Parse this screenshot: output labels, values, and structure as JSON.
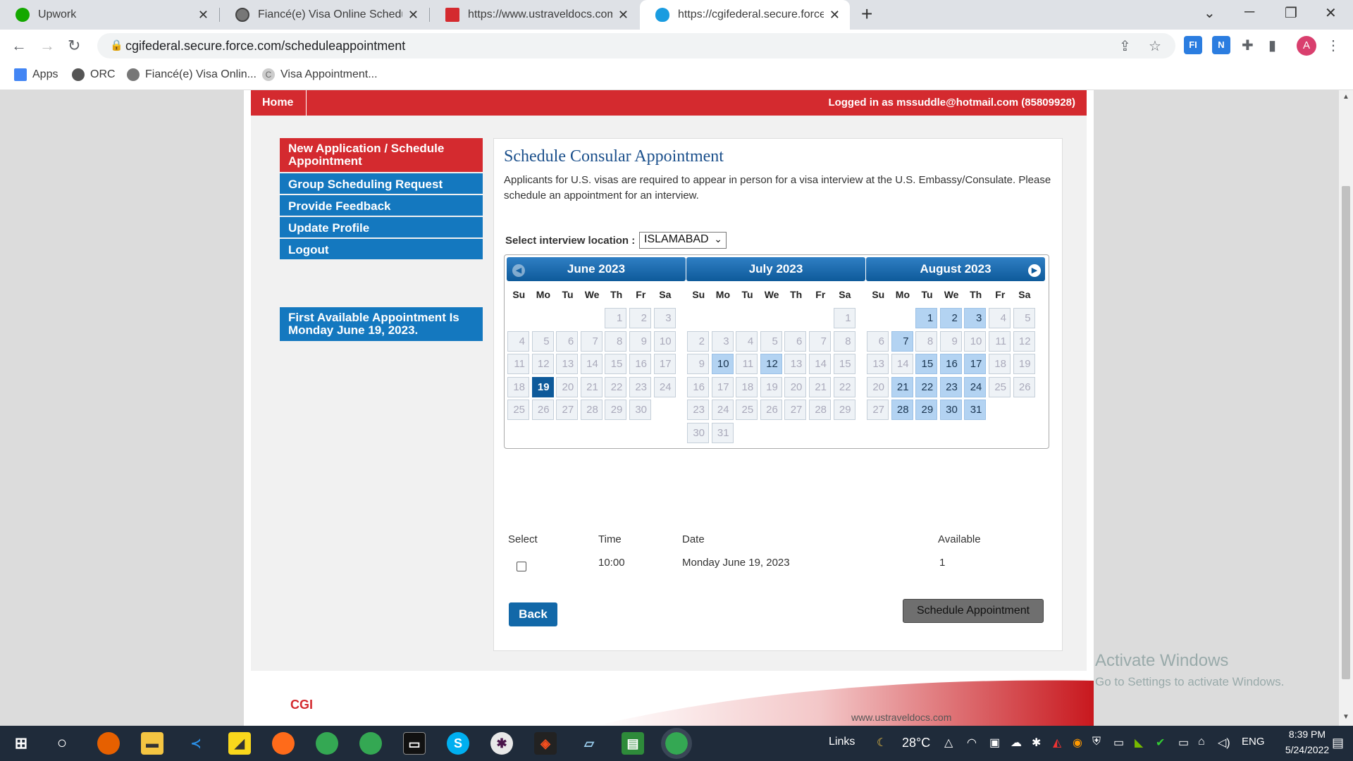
{
  "browser": {
    "tabs": [
      {
        "title": "Upwork"
      },
      {
        "title": "Fiancé(e) Visa Online Scheduling"
      },
      {
        "title": "https://www.ustraveldocs.com/pk"
      },
      {
        "title": "https://cgifederal.secure.force.com"
      }
    ],
    "url": "cgifederal.secure.force.com/scheduleappointment",
    "bookmarks": [
      "Apps",
      "ORC",
      "Fiancé(e) Visa Onlin...",
      "Visa Appointment..."
    ],
    "avatar_letter": "A"
  },
  "header": {
    "home_label": "Home",
    "logged_in_text": "Logged in as  mssuddle@hotmail.com (85809928)"
  },
  "sidebar": {
    "items": [
      {
        "label": "New Application / Schedule Appointment"
      },
      {
        "label": "Group Scheduling Request"
      },
      {
        "label": "Provide Feedback"
      },
      {
        "label": "Update Profile"
      },
      {
        "label": "Logout"
      }
    ],
    "first_available": "First Available Appointment Is Monday June 19, 2023."
  },
  "main": {
    "title": "Schedule Consular Appointment",
    "description": "Applicants for U.S. visas are required to appear in person for a visa interview at the U.S. Embassy/Consulate. Please schedule an appointment for an interview.",
    "location_label": "Select interview location :",
    "location_value": "ISLAMABAD",
    "weekday_headers": [
      "Su",
      "Mo",
      "Tu",
      "We",
      "Th",
      "Fr",
      "Sa"
    ],
    "calendar": [
      {
        "title": "June 2023",
        "first_weekday": 4,
        "days": 30,
        "available": [],
        "selected": 19
      },
      {
        "title": "July 2023",
        "first_weekday": 6,
        "days": 31,
        "available": [
          10,
          12
        ],
        "selected": null
      },
      {
        "title": "August 2023",
        "first_weekday": 2,
        "days": 31,
        "available": [
          1,
          2,
          3,
          7,
          15,
          16,
          17,
          21,
          22,
          23,
          24,
          28,
          29,
          30,
          31
        ],
        "selected": null
      }
    ],
    "table": {
      "headers": [
        "Select",
        "Time",
        "Date",
        "Available"
      ],
      "rows": [
        {
          "time": "10:00",
          "date": "Monday June 19, 2023",
          "available": "1"
        }
      ]
    },
    "back_label": "Back",
    "schedule_label": "Schedule Appointment"
  },
  "footer": {
    "logo": "CGI",
    "url": "www.ustraveldocs.com"
  },
  "watermark": {
    "line1": "Activate Windows",
    "line2": "Go to Settings to activate Windows."
  },
  "taskbar": {
    "links_label": "Links",
    "temperature": "28°C",
    "lang": "ENG",
    "time": "8:39 PM",
    "date": "5/24/2022"
  },
  "colors": {
    "brand_red": "#d42a2f",
    "brand_blue": "#1478bf",
    "available_day": "#b3d3f2",
    "selected_day": "#0e5a9a"
  }
}
